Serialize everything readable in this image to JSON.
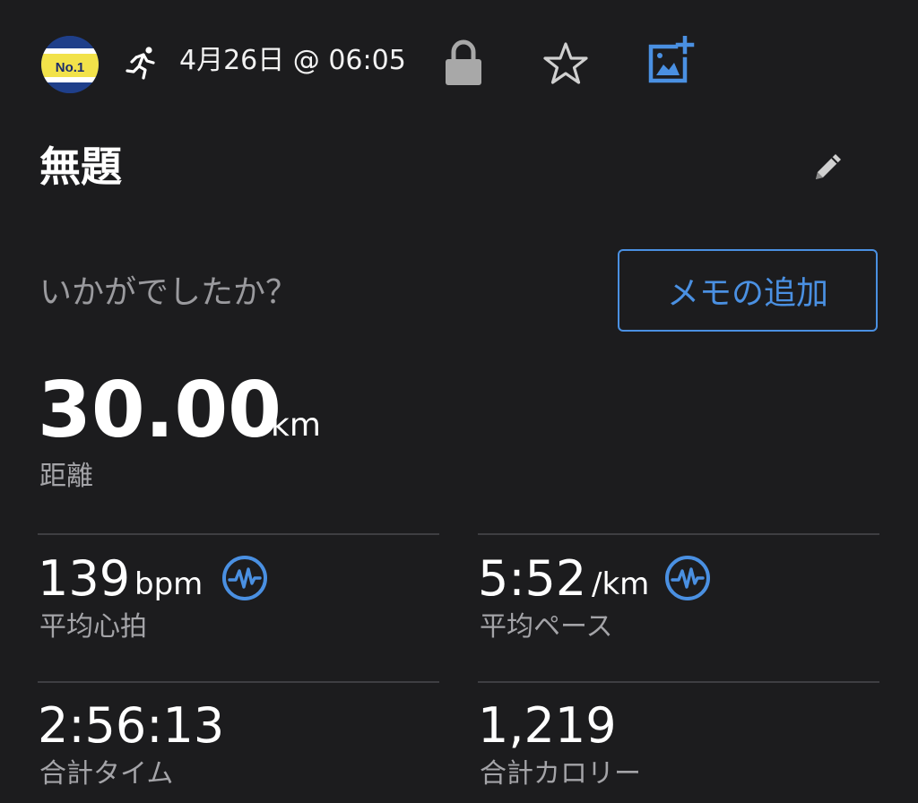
{
  "header": {
    "avatar_icon": "race-bib-avatar-icon",
    "activity_icon": "running-person-icon",
    "date_time": "4月26日 @ 06:05",
    "lock_icon": "lock-icon",
    "star_icon": "star-outline-icon",
    "add_photo_icon": "add-photo-icon"
  },
  "activity": {
    "title": "無題",
    "edit_icon": "pencil-icon",
    "prompt": "いかがでしたか？",
    "memo_button_label": "メモの追加"
  },
  "distance": {
    "value": "30.00",
    "unit": "km",
    "label": "距離"
  },
  "stats": [
    {
      "value": "139",
      "unit": "bpm",
      "label": "平均心拍",
      "icon": "heart-rate-wave-icon"
    },
    {
      "value": "5:52",
      "unit": "/km",
      "label": "平均ペース",
      "icon": "heart-rate-wave-icon"
    },
    {
      "value": "2:56:13",
      "unit": "",
      "label": "合計タイム"
    },
    {
      "value": "1,219",
      "unit": "",
      "label": "合計カロリー"
    }
  ],
  "colors": {
    "background": "#1c1c1e",
    "accent": "#4a90e2",
    "secondary_text": "#a4a4a8",
    "lock_gray": "#a8a8a8"
  }
}
